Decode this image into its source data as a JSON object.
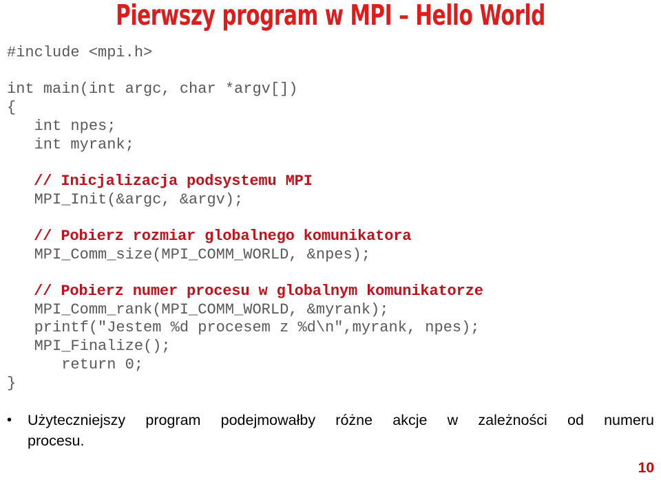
{
  "slide": {
    "title": "Pierwszy program w MPI – Hello World",
    "page_number": "10",
    "title_color": "#dd1c1c",
    "comment_color": "#c1121c",
    "code_color": "#59595b",
    "page_number_color": "#cc0000"
  },
  "code": {
    "lines": [
      {
        "indent": 0,
        "type": "code",
        "text": "#include <mpi.h>"
      },
      {
        "indent": 0,
        "type": "blank",
        "text": ""
      },
      {
        "indent": 0,
        "type": "code",
        "text": "int main(int argc, char *argv[])"
      },
      {
        "indent": 0,
        "type": "code",
        "text": "{"
      },
      {
        "indent": 1,
        "type": "code",
        "text": "int npes;"
      },
      {
        "indent": 1,
        "type": "code",
        "text": "int myrank;"
      },
      {
        "indent": 0,
        "type": "blank",
        "text": ""
      },
      {
        "indent": 1,
        "type": "comment",
        "text": "// Inicjalizacja podsystemu MPI"
      },
      {
        "indent": 1,
        "type": "code",
        "text": "MPI_Init(&argc, &argv);"
      },
      {
        "indent": 0,
        "type": "blank",
        "text": ""
      },
      {
        "indent": 1,
        "type": "comment",
        "text": "// Pobierz rozmiar globalnego komunikatora"
      },
      {
        "indent": 1,
        "type": "code",
        "text": "MPI_Comm_size(MPI_COMM_WORLD, &npes);"
      },
      {
        "indent": 0,
        "type": "blank",
        "text": ""
      },
      {
        "indent": 1,
        "type": "comment",
        "text": "// Pobierz numer procesu w globalnym komunikatorze"
      },
      {
        "indent": 1,
        "type": "code",
        "text": "MPI_Comm_rank(MPI_COMM_WORLD, &myrank);"
      },
      {
        "indent": 1,
        "type": "code",
        "text": "printf(\"Jestem %d procesem z %d\\n\",myrank, npes);"
      },
      {
        "indent": 1,
        "type": "code",
        "text": "MPI_Finalize();"
      },
      {
        "indent": 2,
        "type": "code",
        "text": "return 0;"
      },
      {
        "indent": 0,
        "type": "code",
        "text": "}"
      }
    ]
  },
  "bullets": [
    {
      "marker": "•",
      "line1": "Użyteczniejszy program podejmowałby różne akcje w zależności od numeru",
      "line2": "procesu."
    }
  ]
}
